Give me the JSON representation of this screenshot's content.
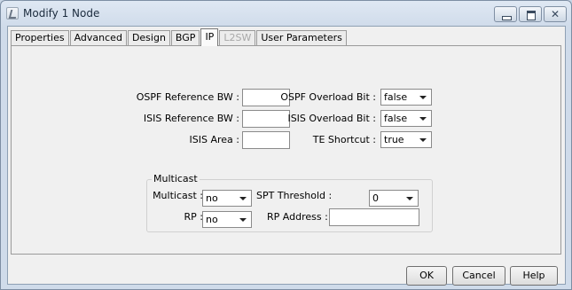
{
  "window": {
    "title": "Modify 1 Node"
  },
  "title_controls": {
    "close_glyph": "✕"
  },
  "tabs": [
    {
      "label": "Properties",
      "state": "normal"
    },
    {
      "label": "Advanced",
      "state": "normal"
    },
    {
      "label": "Design",
      "state": "normal"
    },
    {
      "label": "BGP",
      "state": "normal"
    },
    {
      "label": "IP",
      "state": "active"
    },
    {
      "label": "L2SW",
      "state": "disabled"
    },
    {
      "label": "User Parameters",
      "state": "normal"
    }
  ],
  "form": {
    "ospf_ref_bw": {
      "label": "OSPF Reference BW :",
      "value": ""
    },
    "isis_ref_bw": {
      "label": "ISIS Reference BW :",
      "value": ""
    },
    "isis_area": {
      "label": "ISIS Area :",
      "value": ""
    },
    "ospf_overload_bit": {
      "label": "OSPF Overload Bit :",
      "value": "false"
    },
    "isis_overload_bit": {
      "label": "ISIS Overload Bit :",
      "value": "false"
    },
    "te_shortcut": {
      "label": "TE Shortcut :",
      "value": "true"
    }
  },
  "multicast_group": {
    "title": "Multicast",
    "multicast": {
      "label": "Multicast :",
      "value": "no"
    },
    "spt_threshold": {
      "label": "SPT Threshold :",
      "value": "0"
    },
    "rp": {
      "label": "RP :",
      "value": "no"
    },
    "rp_address": {
      "label": "RP Address :",
      "value": ""
    }
  },
  "buttons": {
    "ok": "OK",
    "cancel": "Cancel",
    "help": "Help"
  }
}
